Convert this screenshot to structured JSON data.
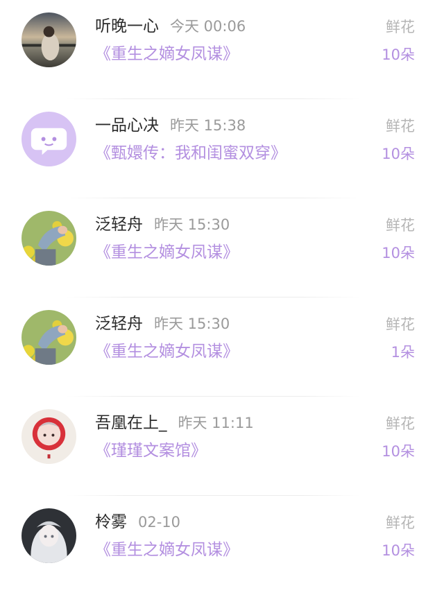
{
  "list": {
    "items": [
      {
        "user": "听晚一心",
        "time": "今天 00:06",
        "book": "《重生之嫡女凤谋》",
        "gift": "鲜花",
        "count": "10朵",
        "avatar": "landscape-photo-avatar"
      },
      {
        "user": "一品心决",
        "time": "昨天 15:38",
        "book": "《甄嬛传：我和闺蜜双穿》",
        "gift": "鲜花",
        "count": "10朵",
        "avatar": "chat-bubble-avatar-icon"
      },
      {
        "user": "泛轻舟",
        "time": "昨天 15:30",
        "book": "《重生之嫡女凤谋》",
        "gift": "鲜花",
        "count": "10朵",
        "avatar": "flower-field-avatar"
      },
      {
        "user": "泛轻舟",
        "time": "昨天 15:30",
        "book": "《重生之嫡女凤谋》",
        "gift": "鲜花",
        "count": "1朵",
        "avatar": "flower-field-avatar"
      },
      {
        "user": "吾凰在上_",
        "time": "昨天 11:11",
        "book": "《瑾瑾文案馆》",
        "gift": "鲜花",
        "count": "10朵",
        "avatar": "anime-girl-red-avatar"
      },
      {
        "user": "柃雾",
        "time": "02-10",
        "book": "《重生之嫡女凤谋》",
        "gift": "鲜花",
        "count": "10朵",
        "avatar": "anime-girl-white-avatar"
      }
    ]
  },
  "colors": {
    "accent": "#b38fe0",
    "name_text": "#2b2b2b",
    "time_text": "#9a9a9a",
    "gift_text": "#b5b5b5",
    "chat_avatar_bg": "#d7c3f4"
  }
}
